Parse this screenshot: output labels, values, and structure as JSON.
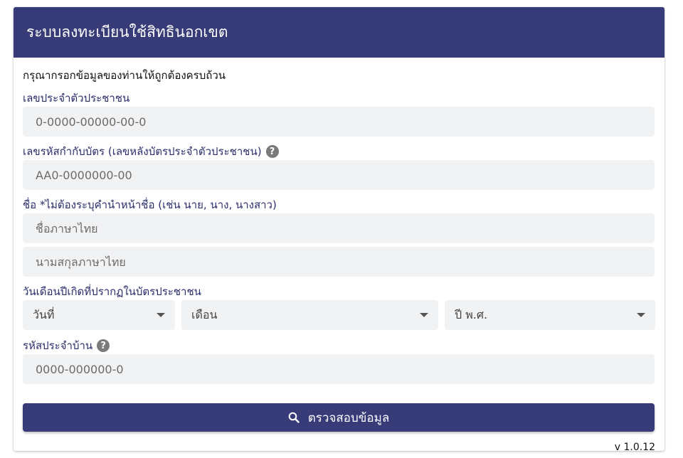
{
  "header": {
    "title": "ระบบลงทะเบียนใช้สิทธินอกเขต"
  },
  "form": {
    "instruction": "กรุณากรอกข้อมูลของท่านให้ถูกต้องครบถ้วน",
    "citizen_id": {
      "label": "เลขประจำตัวประชาชน",
      "placeholder": "0-0000-00000-00-0"
    },
    "laser_code": {
      "label": "เลขรหัสกำกับบัตร (เลขหลังบัตรประจำตัวประชาชน)",
      "placeholder": "AA0-0000000-00"
    },
    "name": {
      "label": "ชื่อ *ไม่ต้องระบุคำนำหน้าชื่อ (เช่น นาย, นาง, นางสาว)",
      "first_placeholder": "ชื่อภาษาไทย",
      "last_placeholder": "นามสกุลภาษาไทย"
    },
    "birthdate": {
      "label": "วันเดือนปีเกิดที่ปรากฏในบัตรประชาชน",
      "day": "วันที่",
      "month": "เดือน",
      "year": "ปี พ.ศ."
    },
    "house_code": {
      "label": "รหัสประจำบ้าน",
      "placeholder": "0000-000000-0"
    },
    "submit_label": "ตรวจสอบข้อมูล"
  },
  "footer": {
    "version": "v 1.0.12"
  },
  "icons": {
    "help": "help-icon",
    "search": "search-icon",
    "dropdown": "chevron-down-icon"
  },
  "colors": {
    "primary": "#373b77",
    "field_bg": "#f1f2f4"
  }
}
